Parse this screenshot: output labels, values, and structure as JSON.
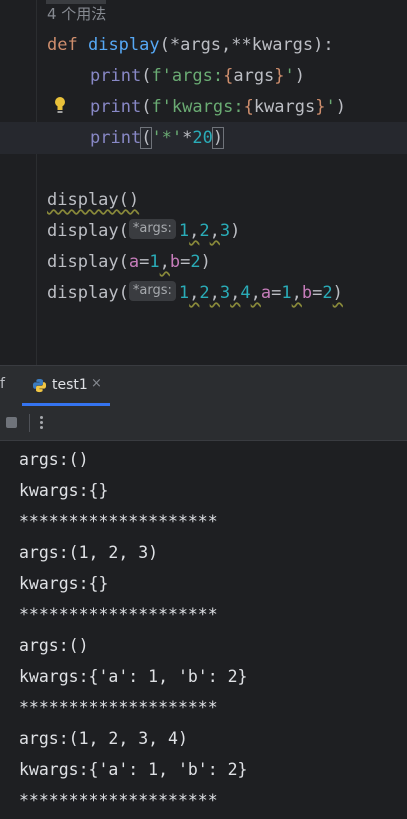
{
  "editor": {
    "usages_hint": "4 个用法",
    "def_kw": "def",
    "def_name": "display",
    "def_params": "(*args,**kwargs):",
    "print1": {
      "fn": "print",
      "open": "(",
      "str_prefix": "f'args:",
      "lb": "{",
      "var": "args",
      "rb": "}",
      "str_end": "'",
      "close": ")"
    },
    "print2": {
      "fn": "print",
      "open": "(",
      "str_prefix": "f'kwargs:",
      "lb": "{",
      "var": "kwargs",
      "rb": "}",
      "str_end": "'",
      "close": ")"
    },
    "print3": {
      "fn": "print",
      "open": "(",
      "str": "'*'",
      "op": "*",
      "num": "20",
      "close": ")"
    },
    "call1": "display()",
    "call2": {
      "name": "display",
      "hint": "*args:",
      "a": "1",
      "b": "2",
      "c": "3"
    },
    "call3": {
      "name": "display",
      "k1": "a",
      "v1": "1",
      "k2": "b",
      "v2": "2"
    },
    "call4": {
      "name": "display",
      "hint": "*args:",
      "n1": "1",
      "n2": "2",
      "n3": "3",
      "n4": "4",
      "k1": "a",
      "v1": "1",
      "k2": "b",
      "v2": "2"
    }
  },
  "run_panel": {
    "prev_tab_fragment": "f",
    "active_tab": "test1",
    "close_glyph": "×"
  },
  "output_lines": [
    "args:()",
    "kwargs:{}",
    "********************",
    "args:(1, 2, 3)",
    "kwargs:{}",
    "********************",
    "args:()",
    "kwargs:{'a': 1, 'b': 2}",
    "********************",
    "args:(1, 2, 3, 4)",
    "kwargs:{'a': 1, 'b': 2}",
    "********************"
  ],
  "colors": {
    "background": "#1e1f22",
    "keyword": "#cf8e6d",
    "function": "#56a8f5",
    "string": "#6aab73",
    "number": "#2aacb8",
    "param": "#c77dbb",
    "accent": "#3574f0"
  },
  "icons": [
    "lightbulb-icon",
    "python-icon",
    "close-icon",
    "stop-icon",
    "more-options-icon"
  ]
}
